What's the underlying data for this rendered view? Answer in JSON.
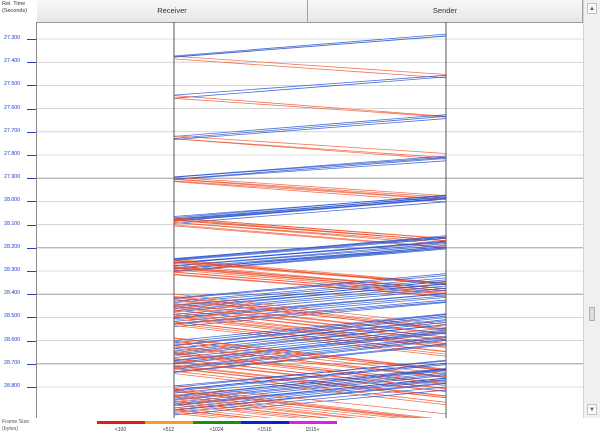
{
  "header": {
    "axis_title_line1": "Rel. Time",
    "axis_title_line2": "(Seconds)",
    "columns": [
      {
        "label": "Receiver"
      },
      {
        "label": "Sender"
      }
    ]
  },
  "time_axis": {
    "labels": [
      "27.300",
      "27.400",
      "27.500",
      "27.600",
      "27.700",
      "27.800",
      "27.900",
      "28.000",
      "28.100",
      "28.200",
      "28.300",
      "28.400",
      "28.500",
      "28.600",
      "28.700",
      "28.800"
    ],
    "start": 27.3,
    "step": 0.1
  },
  "legend": {
    "title_line1": "Frame Size",
    "title_line2": "(bytes)",
    "items": [
      {
        "label": "<100",
        "color": "#e81818"
      },
      {
        "label": "<512",
        "color": "#f0a020"
      },
      {
        "label": "<1024",
        "color": "#189018"
      },
      {
        "label": "<1515",
        "color": "#1020d0"
      },
      {
        "label": "1515+",
        "color": "#e020e0"
      }
    ]
  },
  "colors": {
    "data_to_receiver": "#2a55d0",
    "ack_to_sender": "#f0502a",
    "tick_blue": "#1f3fc8"
  },
  "icons": {
    "scroll_up": "▲",
    "scroll_down": "▼"
  }
}
